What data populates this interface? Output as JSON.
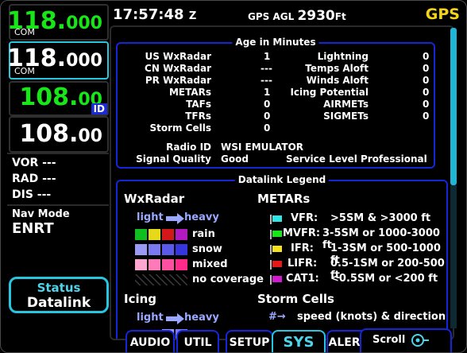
{
  "left": {
    "com1": {
      "active": {
        "big": "118.",
        "small": "000"
      },
      "label": "COM"
    },
    "com2": {
      "active": {
        "big": "118.",
        "small": "000"
      },
      "label": "COM"
    },
    "nav1": {
      "big": "108.",
      "small": "00",
      "id": "ID"
    },
    "nav2": {
      "big": "108.",
      "small": "00"
    },
    "vor": {
      "label": "VOR",
      "value": "---"
    },
    "rad": {
      "label": "RAD",
      "value": "---"
    },
    "dis": {
      "label": "DIS",
      "value": "---"
    },
    "nav_mode": {
      "label": "Nav Mode",
      "value": "ENRT"
    },
    "status_button": {
      "line1": "Status",
      "line2": "Datalink"
    }
  },
  "top": {
    "time": "17:57:48",
    "time_zone": "Z",
    "gps_agl_label": "GPS AGL",
    "gps_agl_value": "2930",
    "gps_agl_unit": "Ft",
    "nav_source": "GPS"
  },
  "age": {
    "title": "Age in Minutes",
    "left": [
      {
        "label": "US WxRadar",
        "value": "1"
      },
      {
        "label": "CN WxRadar",
        "value": "---"
      },
      {
        "label": "PR WxRadar",
        "value": "---"
      },
      {
        "label": "METARs",
        "value": "1"
      },
      {
        "label": "TAFs",
        "value": "0"
      },
      {
        "label": "TFRs",
        "value": "0"
      },
      {
        "label": "Storm Cells",
        "value": "0"
      }
    ],
    "right": [
      {
        "label": "Lightning",
        "value": "0"
      },
      {
        "label": "Temps Aloft",
        "value": "0"
      },
      {
        "label": "Winds Aloft",
        "value": "0"
      },
      {
        "label": "Icing Potential",
        "value": "0"
      },
      {
        "label": "AIRMETs",
        "value": "0"
      },
      {
        "label": "SIGMETs",
        "value": "0"
      }
    ],
    "radio_id_label": "Radio ID",
    "radio_id_value": "WSI EMULATOR",
    "signal_label": "Signal Quality",
    "signal_value": "Good",
    "service_label": "Service Level",
    "service_value": "Professional"
  },
  "legend": {
    "title": "Datalink Legend",
    "wxradar": {
      "title": "WxRadar",
      "light": "light",
      "heavy": "heavy",
      "rain": "rain",
      "snow": "snow",
      "mixed": "mixed",
      "no_coverage": "no coverage",
      "rain_colors": [
        "#0fbf1f",
        "#e6d91a",
        "#d21818",
        "#b01ac0"
      ],
      "snow_colors": [
        "#9a9af5",
        "#7a7af0",
        "#5a5aea",
        "#3636e0"
      ],
      "mixed_colors": [
        "#ffa6d0",
        "#ff7ab8",
        "#ff4fa0",
        "#ff2a8a"
      ]
    },
    "metars": {
      "title": "METARs",
      "rows": [
        {
          "cat": "VFR:",
          "desc": ">5SM & >3000 ft",
          "color": "#2ee6e6"
        },
        {
          "cat": "MVFR:",
          "desc": "3-5SM or 1000-3000 ft",
          "color": "#19e619"
        },
        {
          "cat": "IFR:",
          "desc": "1-3SM or 500-1000 ft",
          "color": "#f6e21a"
        },
        {
          "cat": "LIFR:",
          "desc": "0.5-1SM or 200-500 ft",
          "color": "#e61919"
        },
        {
          "cat": "CAT1:",
          "desc": "<0.5SM or <200 ft",
          "color": "#d21ad2"
        }
      ]
    },
    "icing": {
      "title": "Icing",
      "light": "light",
      "heavy": "heavy"
    },
    "storm_cells": {
      "title": "Storm Cells",
      "symbol": "#→",
      "desc": "speed (knots) & direction"
    }
  },
  "tabs": [
    "AUDIO",
    "UTIL",
    "SETUP",
    "SYS",
    "ALERT"
  ],
  "scroll_label": "Scroll"
}
